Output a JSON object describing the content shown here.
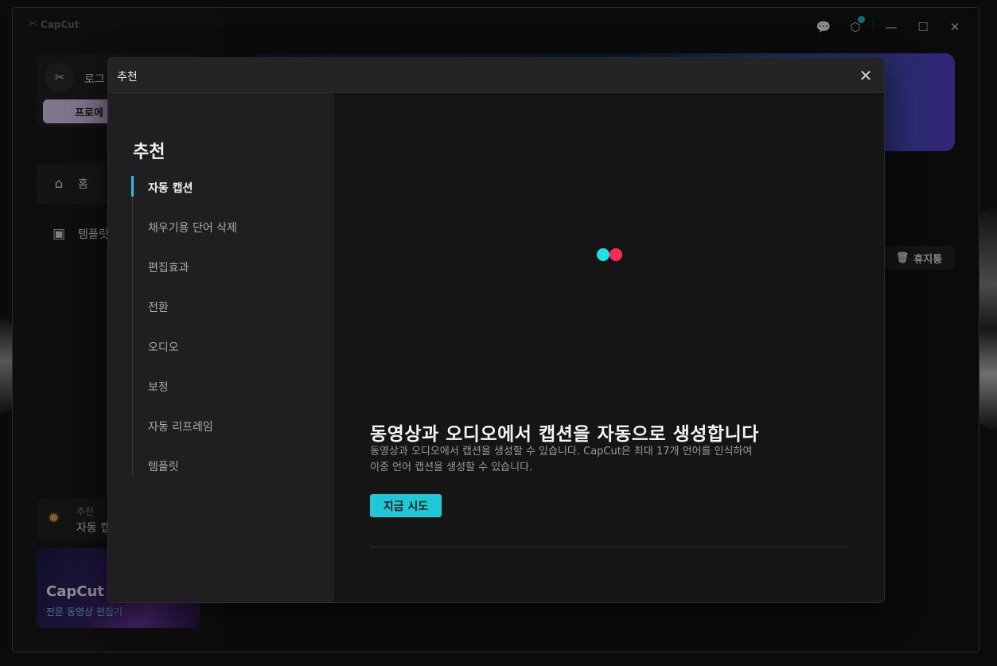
{
  "app": {
    "brand": "CapCut"
  },
  "titlebar": {
    "feedback_icon": "chat-feedback-icon",
    "settings_icon": "hexagon-settings-icon",
    "minimize_icon": "minimize-icon",
    "maximize_icon": "maximize-icon",
    "close_icon": "close-icon",
    "notify_color": "#1ec8d6"
  },
  "sidebar": {
    "profile_name": "로그",
    "pro_button": "프로에",
    "nav": [
      {
        "label": "홈",
        "icon": "home-icon"
      },
      {
        "label": "템플릿",
        "icon": "template-icon"
      }
    ],
    "tip": {
      "title": "추천",
      "subtitle": "자동 캡"
    },
    "promo": {
      "brand": "CapCut",
      "subtitle": "전문 동영상 편집기"
    }
  },
  "main": {
    "trash_label": "휴지통"
  },
  "dialog": {
    "title": "추천",
    "sidebar_heading": "추천",
    "items": [
      {
        "label": "자동 캡션",
        "active": true
      },
      {
        "label": "채우기용 단어 삭제",
        "active": false
      },
      {
        "label": "편집효과",
        "active": false
      },
      {
        "label": "전환",
        "active": false
      },
      {
        "label": "오디오",
        "active": false
      },
      {
        "label": "보정",
        "active": false
      },
      {
        "label": "자동 리프레임",
        "active": false
      },
      {
        "label": "템플릿",
        "active": false
      }
    ],
    "feature_title": "동영상과 오디오에서 캡션을 자동으로 생성합니다",
    "feature_desc_1": "동영상과 오디오에서 캡션을 생성할 수 있습니다. CapCut은 최대 17개 언어를 인식하여",
    "feature_desc_2": "이중 언어 캡션을 생성할 수 있습니다.",
    "try_button": "지금 시도",
    "accent": "#1ec8d6",
    "loader_colors": [
      "#1ee3e8",
      "#ff2a5a"
    ]
  }
}
